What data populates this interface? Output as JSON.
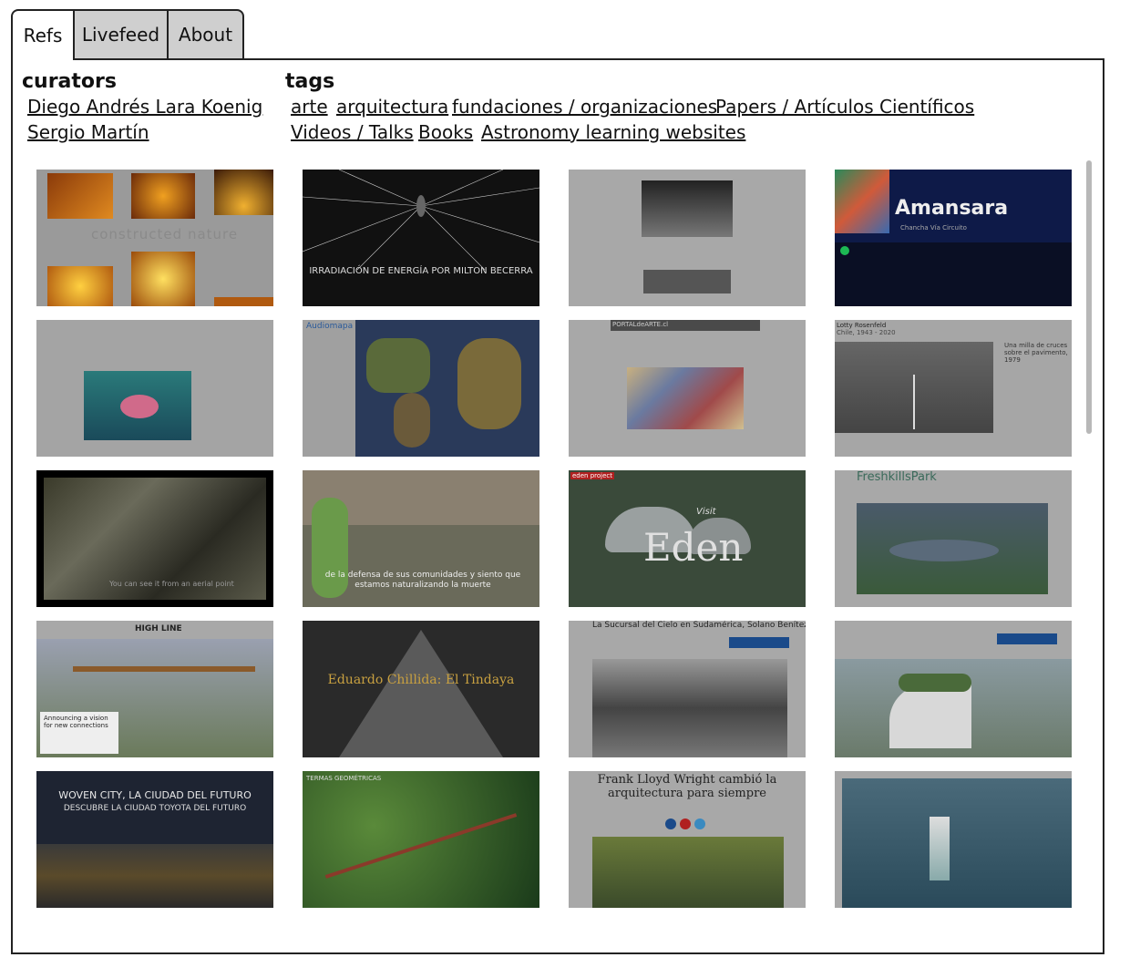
{
  "tabs": [
    {
      "label": "Refs"
    },
    {
      "label": "Livefeed"
    },
    {
      "label": "About"
    }
  ],
  "curators": {
    "title": "curators",
    "items": [
      "Diego Andrés Lara Koenig",
      "Sergio Martín"
    ]
  },
  "tags": {
    "title": "tags",
    "items": [
      "arte",
      "arquitectura",
      "fundaciones / organizaciones",
      "Papers / Artículos Científicos",
      "Videos / Talks",
      "Books",
      "Astronomy learning websites"
    ]
  },
  "thumbnails": {
    "t1": {
      "caption": "constructed nature"
    },
    "t2": {
      "caption": "IRRADIACIÓN DE ENERGÍA POR MILTON BECERRA"
    },
    "t4": {
      "brand": "Amansara",
      "artist": "Chancha Vía Circuito"
    },
    "t6": {
      "brand": "Audiomapa"
    },
    "t7": {
      "brand": "PORTALdeARTE.cl"
    },
    "t8": {
      "title": "Lotty Rosenfeld",
      "subtitle": "Chile, 1943 - 2020",
      "caption": "Una milla de cruces sobre el pavimento, 1979"
    },
    "t9": {
      "caption": "You can see it from an aerial point"
    },
    "t10": {
      "caption": "de la defensa de sus comunidades y siento que estamos naturalizando la muerte"
    },
    "t11": {
      "brand": "eden project",
      "caption": "Eden",
      "caption_small": "Visit"
    },
    "t12": {
      "brand": "FreshkillsPark"
    },
    "t13": {
      "brand": "HIGH LINE",
      "caption": "Announcing a vision for new connections"
    },
    "t14": {
      "caption": "Eduardo Chillida: El Tindaya"
    },
    "t15": {
      "caption": "La Sucursal del Cielo en Sudamérica, Solano Benítez"
    },
    "t17": {
      "caption": "WOVEN CITY, LA CIUDAD DEL FUTURO",
      "caption2": "DESCUBRE LA CIUDAD TOYOTA DEL FUTURO"
    },
    "t18": {
      "brand": "TERMAS GEOMÉTRICAS"
    },
    "t19": {
      "caption": "Frank Lloyd Wright cambió la arquitectura para siempre"
    }
  },
  "colors": {
    "tab_inactive": "#cfcfcf",
    "border": "#222222"
  }
}
